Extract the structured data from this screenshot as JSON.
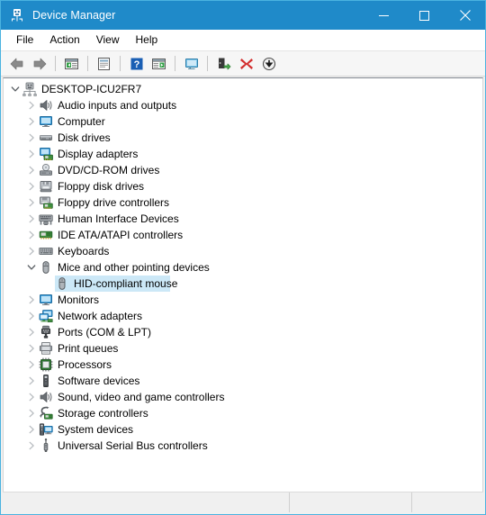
{
  "window": {
    "title": "Device Manager",
    "title_icon": "device-manager-icon",
    "titlebar_color": "#1f8ac9",
    "border_color": "#4ab3e0",
    "controls": [
      {
        "name": "minimize",
        "glyph": "minimize-icon"
      },
      {
        "name": "maximize",
        "glyph": "maximize-icon"
      },
      {
        "name": "close",
        "glyph": "close-icon"
      }
    ]
  },
  "menubar": {
    "items": [
      {
        "label": "File"
      },
      {
        "label": "Action"
      },
      {
        "label": "View"
      },
      {
        "label": "Help"
      }
    ]
  },
  "toolbar": {
    "buttons": [
      {
        "name": "back-button",
        "icon": "back-arrow-icon"
      },
      {
        "name": "forward-button",
        "icon": "forward-arrow-icon"
      },
      {
        "name": "separator-1",
        "icon": "separator"
      },
      {
        "name": "show-hide-console-tree-button",
        "icon": "console-tree-icon"
      },
      {
        "name": "separator-2",
        "icon": "separator"
      },
      {
        "name": "properties-button",
        "icon": "properties-icon"
      },
      {
        "name": "separator-3",
        "icon": "separator"
      },
      {
        "name": "help-button",
        "icon": "help-question-icon"
      },
      {
        "name": "show-hide-action-pane-button",
        "icon": "action-pane-icon"
      },
      {
        "name": "separator-4",
        "icon": "separator"
      },
      {
        "name": "scan-for-hardware-changes-button",
        "icon": "monitor-scan-icon"
      },
      {
        "name": "separator-5",
        "icon": "separator"
      },
      {
        "name": "update-driver-button",
        "icon": "update-driver-icon"
      },
      {
        "name": "uninstall-device-button",
        "icon": "red-x-icon"
      },
      {
        "name": "disable-device-button",
        "icon": "disable-down-arrow-icon"
      }
    ]
  },
  "tree": {
    "selection_color": "#cce8f7",
    "nodes": [
      {
        "label": "DESKTOP-ICU2FR7",
        "level": 0,
        "state": "expanded",
        "icon": "computer-root-icon",
        "selected": false,
        "sel_width": 0
      },
      {
        "label": "Audio inputs and outputs",
        "level": 1,
        "state": "collapsed",
        "icon": "speaker-icon",
        "selected": false,
        "sel_width": 0
      },
      {
        "label": "Computer",
        "level": 1,
        "state": "collapsed",
        "icon": "monitor-icon",
        "selected": false,
        "sel_width": 0
      },
      {
        "label": "Disk drives",
        "level": 1,
        "state": "collapsed",
        "icon": "disk-drive-icon",
        "selected": false,
        "sel_width": 0
      },
      {
        "label": "Display adapters",
        "level": 1,
        "state": "collapsed",
        "icon": "display-adapter-icon",
        "selected": false,
        "sel_width": 0
      },
      {
        "label": "DVD/CD-ROM drives",
        "level": 1,
        "state": "collapsed",
        "icon": "dvd-drive-icon",
        "selected": false,
        "sel_width": 0
      },
      {
        "label": "Floppy disk drives",
        "level": 1,
        "state": "collapsed",
        "icon": "floppy-disk-icon",
        "selected": false,
        "sel_width": 0
      },
      {
        "label": "Floppy drive controllers",
        "level": 1,
        "state": "collapsed",
        "icon": "floppy-controller-icon",
        "selected": false,
        "sel_width": 0
      },
      {
        "label": "Human Interface Devices",
        "level": 1,
        "state": "collapsed",
        "icon": "hid-devices-icon",
        "selected": false,
        "sel_width": 0
      },
      {
        "label": "IDE ATA/ATAPI controllers",
        "level": 1,
        "state": "collapsed",
        "icon": "ide-controller-icon",
        "selected": false,
        "sel_width": 0
      },
      {
        "label": "Keyboards",
        "level": 1,
        "state": "collapsed",
        "icon": "keyboard-icon",
        "selected": false,
        "sel_width": 0
      },
      {
        "label": "Mice and other pointing devices",
        "level": 1,
        "state": "expanded",
        "icon": "mouse-icon",
        "selected": false,
        "sel_width": 0
      },
      {
        "label": "HID-compliant mouse",
        "level": 2,
        "state": "leaf",
        "icon": "mouse-icon",
        "selected": true,
        "sel_width": 128
      },
      {
        "label": "Monitors",
        "level": 1,
        "state": "collapsed",
        "icon": "monitor-icon",
        "selected": false,
        "sel_width": 0
      },
      {
        "label": "Network adapters",
        "level": 1,
        "state": "collapsed",
        "icon": "network-adapter-icon",
        "selected": false,
        "sel_width": 0
      },
      {
        "label": "Ports (COM & LPT)",
        "level": 1,
        "state": "collapsed",
        "icon": "port-connector-icon",
        "selected": false,
        "sel_width": 0
      },
      {
        "label": "Print queues",
        "level": 1,
        "state": "collapsed",
        "icon": "printer-icon",
        "selected": false,
        "sel_width": 0
      },
      {
        "label": "Processors",
        "level": 1,
        "state": "collapsed",
        "icon": "processor-chip-icon",
        "selected": false,
        "sel_width": 0
      },
      {
        "label": "Software devices",
        "level": 1,
        "state": "collapsed",
        "icon": "software-device-icon",
        "selected": false,
        "sel_width": 0
      },
      {
        "label": "Sound, video and game controllers",
        "level": 1,
        "state": "collapsed",
        "icon": "speaker-icon",
        "selected": false,
        "sel_width": 0
      },
      {
        "label": "Storage controllers",
        "level": 1,
        "state": "collapsed",
        "icon": "storage-controller-icon",
        "selected": false,
        "sel_width": 0
      },
      {
        "label": "System devices",
        "level": 1,
        "state": "collapsed",
        "icon": "system-device-icon",
        "selected": false,
        "sel_width": 0
      },
      {
        "label": "Universal Serial Bus controllers",
        "level": 1,
        "state": "collapsed",
        "icon": "usb-controller-icon",
        "selected": false,
        "sel_width": 0
      }
    ]
  },
  "statusbar": {
    "segments": [
      {
        "text": ""
      },
      {
        "text": ""
      },
      {
        "text": ""
      }
    ]
  }
}
